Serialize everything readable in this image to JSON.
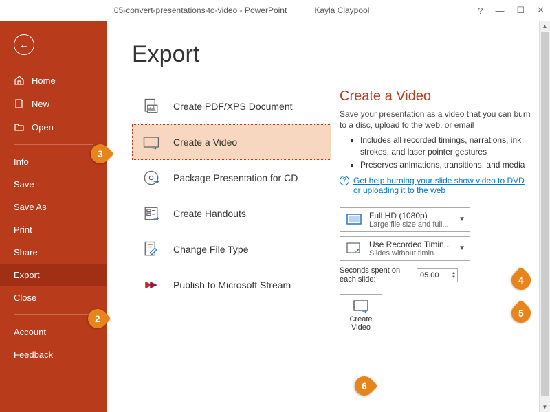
{
  "titlebar": {
    "doc": "05-convert-presentations-to-video  -  PowerPoint",
    "user": "Kayla Claypool",
    "help": "?",
    "min": "—",
    "max": "☐",
    "close": "✕"
  },
  "sidebar": {
    "home": "Home",
    "new": "New",
    "open": "Open",
    "info": "Info",
    "save": "Save",
    "saveas": "Save As",
    "print": "Print",
    "share": "Share",
    "export": "Export",
    "close": "Close",
    "account": "Account",
    "feedback": "Feedback"
  },
  "page": {
    "title": "Export"
  },
  "exportItems": [
    {
      "label": "Create PDF/XPS Document"
    },
    {
      "label": "Create a Video"
    },
    {
      "label": "Package Presentation for CD"
    },
    {
      "label": "Create Handouts"
    },
    {
      "label": "Change File Type"
    },
    {
      "label": "Publish to Microsoft Stream"
    }
  ],
  "right": {
    "heading": "Create a Video",
    "desc": "Save your presentation as a video that you can burn to a disc, upload to the web, or email",
    "bullets": [
      "Includes all recorded timings, narrations, ink strokes, and laser pointer gestures",
      "Preserves animations, transitions, and media"
    ],
    "help": "Get help burning your slide show video to DVD or uploading it to the web",
    "dd1": {
      "title": "Full HD (1080p)",
      "sub": "Large file size and full..."
    },
    "dd2": {
      "title": "Use Recorded Timin...",
      "sub": "Slides without timin..."
    },
    "seconds_label": "Seconds spent on each slide:",
    "seconds_value": "05.00",
    "create_label_1": "Create",
    "create_label_2": "Video"
  },
  "callouts": {
    "c2": "2",
    "c3": "3",
    "c4": "4",
    "c5": "5",
    "c6": "6"
  }
}
